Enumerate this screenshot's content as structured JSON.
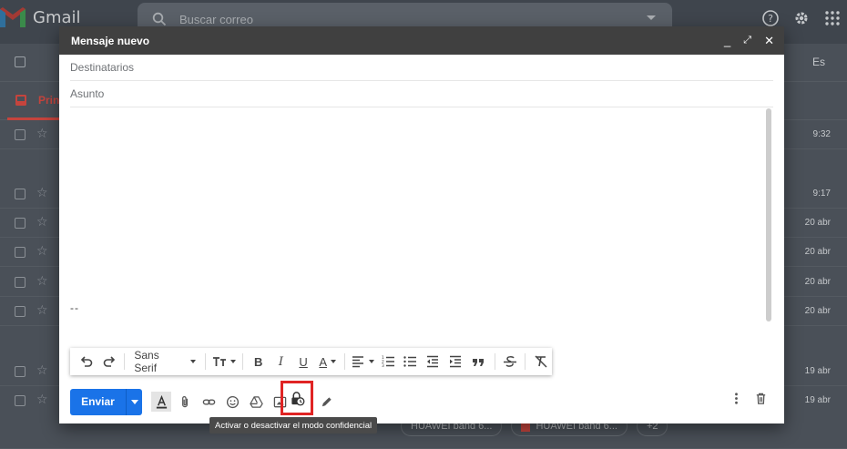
{
  "app": {
    "name": "Gmail"
  },
  "search": {
    "placeholder": "Buscar correo"
  },
  "toolbar": {
    "lang": "Es"
  },
  "tabs": {
    "primary": "Prin"
  },
  "rows": [
    {
      "time": "9:32"
    },
    {
      "time": "9:17"
    },
    {
      "time": "20 abr"
    },
    {
      "time": "20 abr"
    },
    {
      "time": "20 abr"
    },
    {
      "time": "20 abr"
    },
    {
      "time": "19 abr"
    },
    {
      "time": "19 abr"
    }
  ],
  "chips": [
    {
      "label": "HUAWEI band 6..."
    },
    {
      "label": "HUAWEI band 6..."
    },
    {
      "label": "+2"
    }
  ],
  "compose": {
    "title": "Mensaje nuevo",
    "recipients_placeholder": "Destinatarios",
    "subject_placeholder": "Asunto",
    "signature": "--",
    "font": "Sans Serif",
    "send_label": "Enviar",
    "tooltip": "Activar o desactivar el modo confidencial"
  },
  "colors": {
    "send": "#1a73e8",
    "highlight": "#e02424",
    "header": "#404040"
  }
}
